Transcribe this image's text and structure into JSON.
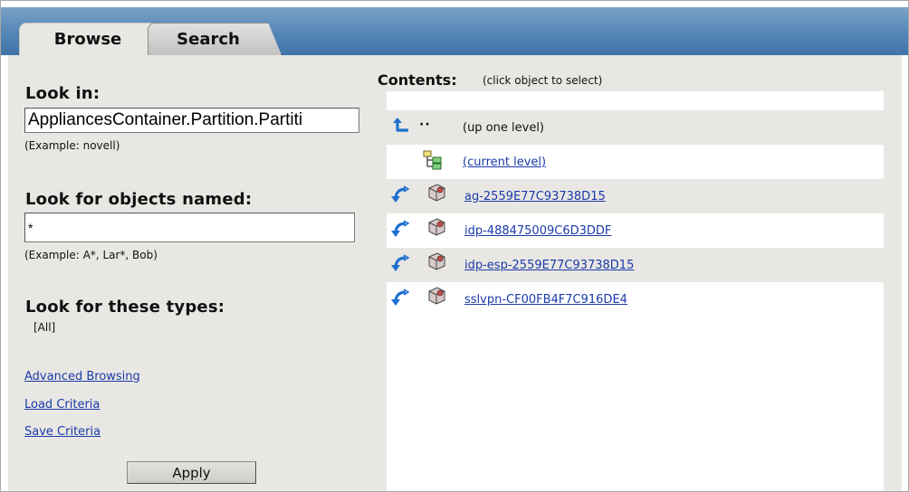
{
  "tabs": [
    {
      "label": "Browse",
      "active": true
    },
    {
      "label": "Search",
      "active": false
    }
  ],
  "left_panel": {
    "look_in": {
      "label": "Look in:",
      "value": "AppliancesContainer.Partition.Partiti",
      "example": "(Example: novell)"
    },
    "look_for_named": {
      "label": "Look for objects named:",
      "value": "*",
      "example": "(Example: A*, Lar*, Bob)"
    },
    "look_for_types": {
      "label": "Look for these types:",
      "value": "[All]"
    },
    "links": {
      "advanced_browsing": "Advanced Browsing",
      "load_criteria": "Load Criteria",
      "save_criteria": "Save Criteria"
    },
    "apply_label": "Apply"
  },
  "contents": {
    "heading": "Contents:",
    "hint": "(click object to select)",
    "up_marker": "··",
    "up_label": "(up one level)",
    "current_label": "(current level)",
    "objects": [
      {
        "name": "ag-2559E77C93738D15"
      },
      {
        "name": "idp-488475009C6D3DDF"
      },
      {
        "name": "idp-esp-2559E77C93738D15"
      },
      {
        "name": "sslvpn-CF00FB4F7C916DE4"
      }
    ]
  },
  "colors": {
    "tab_bar": "#4f7fb0",
    "panel_bg": "#e9e7e4",
    "link": "#1a3aa8",
    "arrow_icon": "#1e6fd0"
  },
  "icons": {
    "up": "arrow-up-left-icon",
    "current": "tree-container-icon",
    "object_action": "curved-arrow-icon",
    "object": "object-icon"
  }
}
